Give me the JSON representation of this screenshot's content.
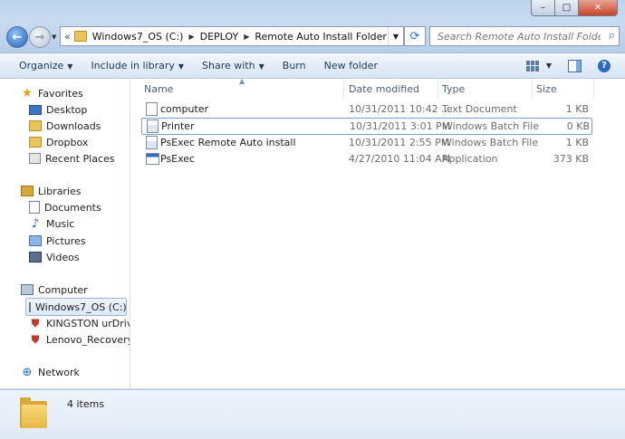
{
  "window": {
    "controls": {
      "minimize": "–",
      "maximize": "□",
      "close": "✕"
    }
  },
  "address": {
    "prefix": "«",
    "crumbs": [
      "Windows7_OS (C:)",
      "DEPLOY",
      "Remote Auto Install Folder"
    ]
  },
  "search": {
    "placeholder": "Search Remote Auto Install Folder"
  },
  "toolbar": {
    "organize": "Organize",
    "include_in_library": "Include in library",
    "share_with": "Share with",
    "burn": "Burn",
    "new_folder": "New folder"
  },
  "nav": {
    "favorites": "Favorites",
    "desktop": "Desktop",
    "downloads": "Downloads",
    "dropbox": "Dropbox",
    "recent_places": "Recent Places",
    "libraries": "Libraries",
    "documents": "Documents",
    "music": "Music",
    "pictures": "Pictures",
    "videos": "Videos",
    "computer": "Computer",
    "windows_os": "Windows7_OS (C:)",
    "kingston": "KINGSTON urDrive (",
    "lenovo_recovery": "Lenovo_Recovery (C",
    "network": "Network"
  },
  "columns": {
    "name": "Name",
    "date_modified": "Date modified",
    "type": "Type",
    "size": "Size"
  },
  "files": [
    {
      "name": "computer",
      "date": "10/31/2011 10:42 ...",
      "type": "Text Document",
      "size": "1 KB",
      "icon": "text-file-icon"
    },
    {
      "name": "Printer",
      "date": "10/31/2011 3:01 PM",
      "type": "Windows Batch File",
      "size": "0 KB",
      "icon": "batch-file-icon"
    },
    {
      "name": "PsExec Remote Auto install",
      "date": "10/31/2011 2:55 PM",
      "type": "Windows Batch File",
      "size": "1 KB",
      "icon": "batch-file-icon"
    },
    {
      "name": "PsExec",
      "date": "4/27/2010 11:04 AM",
      "type": "Application",
      "size": "373 KB",
      "icon": "application-icon"
    }
  ],
  "status": {
    "item_count": "4 items"
  }
}
